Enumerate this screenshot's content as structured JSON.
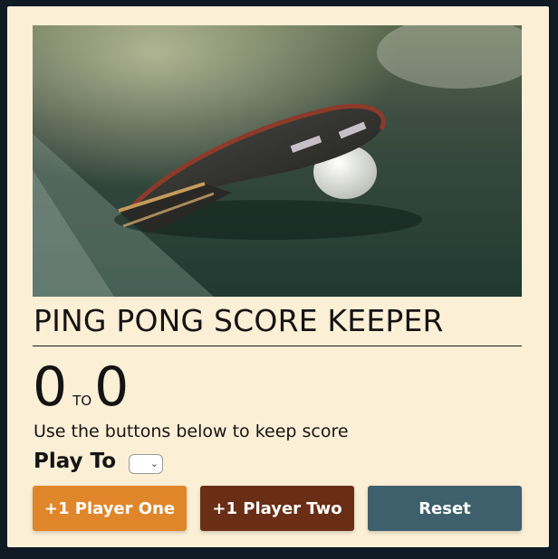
{
  "header": {
    "title": "PING PONG SCORE KEEPER"
  },
  "photo": {
    "subject": "ping-pong-paddle-and-ball"
  },
  "score": {
    "player_one": "0",
    "separator": "TO",
    "player_two": "0"
  },
  "instructions": "Use the buttons below to keep score",
  "play_to": {
    "label": "Play To",
    "selected_value": ""
  },
  "buttons": {
    "player_one": "+1 Player One",
    "player_two": "+1 Player Two",
    "reset": "Reset"
  },
  "colors": {
    "background": "#fbefd6",
    "player_one_button": "#e0862a",
    "player_two_button": "#6a2e16",
    "reset_button": "#3e5f6c"
  }
}
